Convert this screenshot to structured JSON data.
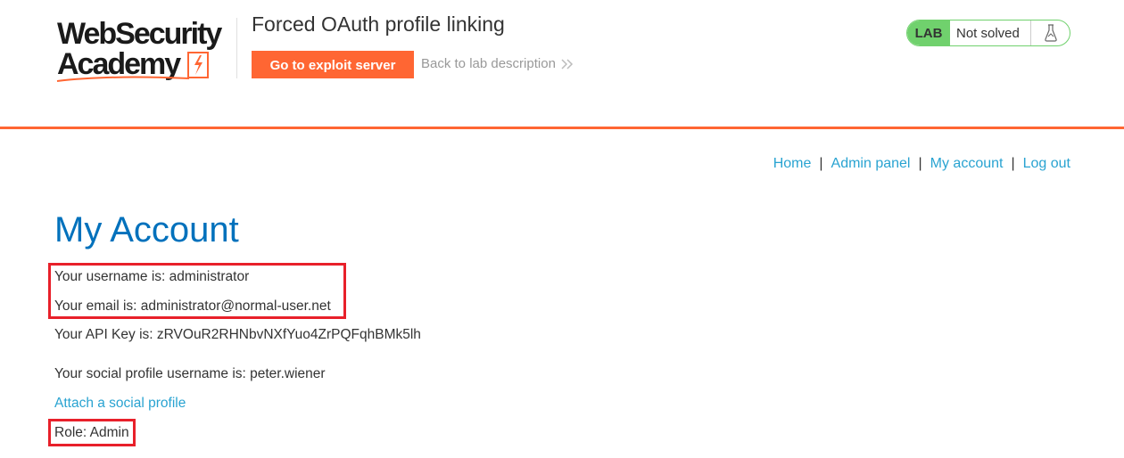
{
  "logo": {
    "line1": "WebSecurity",
    "line2": "Academy",
    "bolt_icon": "lightning-bolt-icon",
    "brand_color": "#ff6633"
  },
  "lab": {
    "title": "Forced OAuth profile linking",
    "exploit_button_label": "Go to exploit server",
    "back_link_label": "Back to lab description",
    "status_badge": "LAB",
    "status_text": "Not solved",
    "status_icon": "flask-icon",
    "status_color": "#70d16d"
  },
  "nav": {
    "items": [
      {
        "label": "Home"
      },
      {
        "label": "Admin panel"
      },
      {
        "label": "My account"
      },
      {
        "label": "Log out"
      }
    ],
    "separator": "|"
  },
  "account": {
    "heading": "My Account",
    "username_line": "Your username is: administrator",
    "email_line": "Your email is: administrator@normal-user.net",
    "api_key_line": "Your API Key is: zRVOuR2RHNbvNXfYuo4ZrPQFqhBMk5lh",
    "social_username_line": "Your social profile username is: peter.wiener",
    "attach_link_label": "Attach a social profile",
    "role_line": "Role: Admin"
  },
  "colors": {
    "heading": "#0071bc",
    "link": "#29a3d1",
    "annotation_box": "#e8202a"
  }
}
